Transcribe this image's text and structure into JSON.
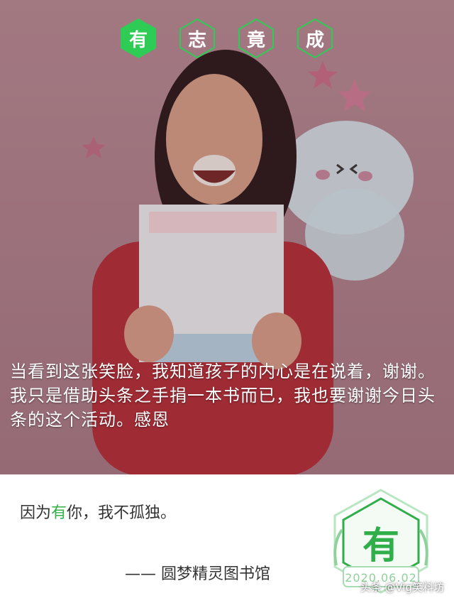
{
  "badges": [
    {
      "char": "有",
      "state": "active"
    },
    {
      "char": "志",
      "state": "outline"
    },
    {
      "char": "竟",
      "state": "outline"
    },
    {
      "char": "成",
      "state": "outline"
    }
  ],
  "caption": "当看到这张笑脸，我知道孩子的内心是在说着，谢谢。我只是借助头条之手捐一本书而已，我也要谢谢今日头条的这个活动。感恩",
  "quote": {
    "before": "因为",
    "highlight": "有",
    "after": "你，我不孤独。"
  },
  "signature": "—— 圆梦精灵图书馆",
  "stamp": {
    "char": "有",
    "date": "2020.06.02"
  },
  "watermark": "头条 @Vig笑料坊",
  "colors": {
    "accent": "#33b04a",
    "badge_fill": "#2ecc55"
  }
}
